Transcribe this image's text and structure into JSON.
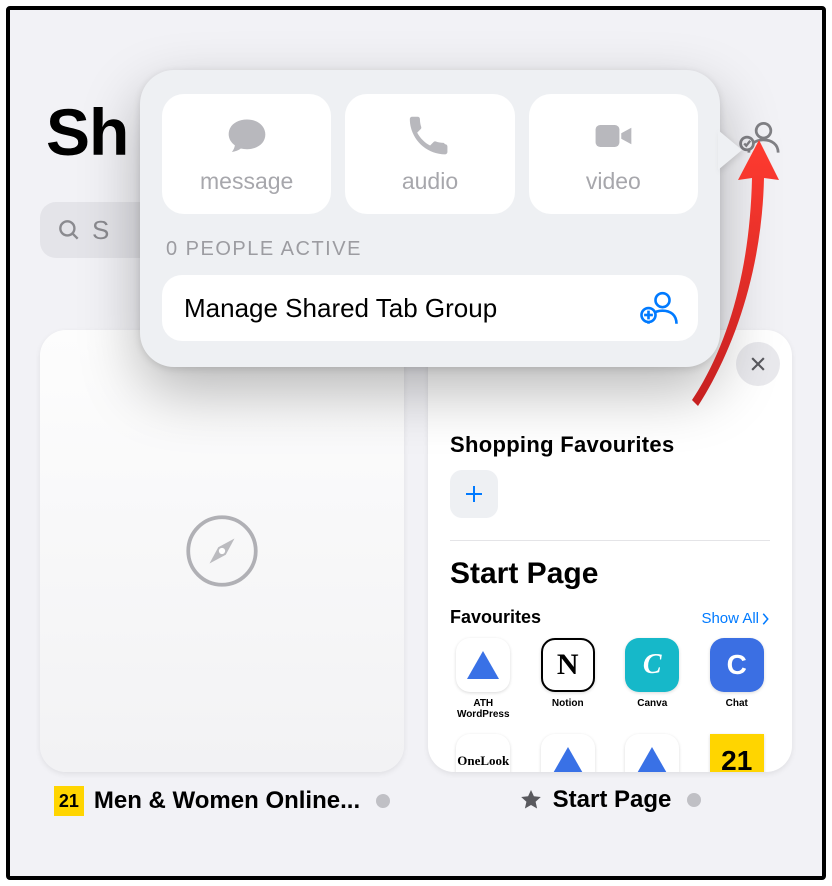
{
  "page": {
    "title": "Sh"
  },
  "search": {
    "placeholder": "S"
  },
  "share_popover": {
    "comm": {
      "message": "message",
      "audio": "audio",
      "video": "video"
    },
    "active_label": "0 PEOPLE ACTIVE",
    "manage_label": "Manage Shared Tab Group"
  },
  "tiles": {
    "left": {
      "label": "Men & Women Online..."
    },
    "right": {
      "close_aria": "Close",
      "section1_title": "Shopping Favourites",
      "start_page_title": "Start Page",
      "favourites_label": "Favourites",
      "show_all": "Show All",
      "label": "Start Page",
      "favs": [
        {
          "name": "ATH WordPress",
          "kind": "triangle"
        },
        {
          "name": "Notion",
          "kind": "notion"
        },
        {
          "name": "Canva",
          "kind": "canva"
        },
        {
          "name": "Chat",
          "kind": "chat"
        },
        {
          "name": "OneLook",
          "kind": "onelook"
        },
        {
          "name": "",
          "kind": "triangle"
        },
        {
          "name": "",
          "kind": "triangle"
        },
        {
          "name": "",
          "kind": "badge21"
        }
      ]
    }
  },
  "icons": {
    "badge21": "21"
  }
}
